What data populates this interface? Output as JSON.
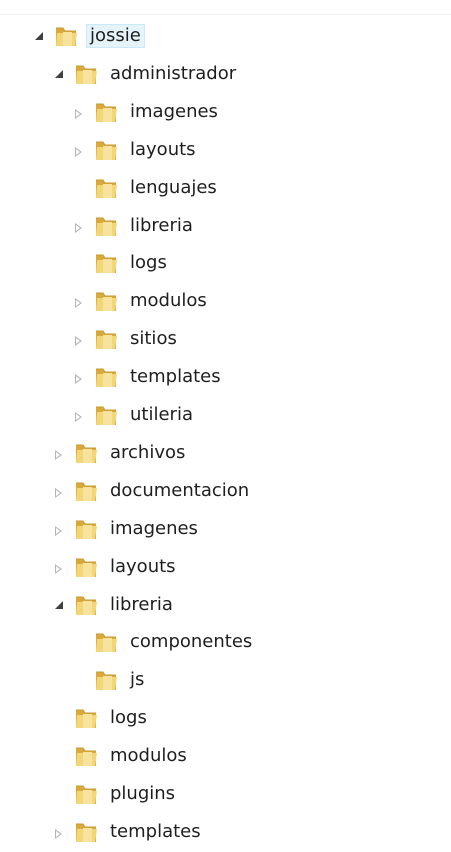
{
  "tree": {
    "nodes": [
      {
        "name": "jossie",
        "depth": 0,
        "state": "expanded",
        "selected": true
      },
      {
        "name": "administrador",
        "depth": 1,
        "state": "expanded"
      },
      {
        "name": "imagenes",
        "depth": 2,
        "state": "collapsed"
      },
      {
        "name": "layouts",
        "depth": 2,
        "state": "collapsed"
      },
      {
        "name": "lenguajes",
        "depth": 2,
        "state": "leaf"
      },
      {
        "name": "libreria",
        "depth": 2,
        "state": "collapsed"
      },
      {
        "name": "logs",
        "depth": 2,
        "state": "leaf"
      },
      {
        "name": "modulos",
        "depth": 2,
        "state": "collapsed"
      },
      {
        "name": "sitios",
        "depth": 2,
        "state": "collapsed"
      },
      {
        "name": "templates",
        "depth": 2,
        "state": "collapsed"
      },
      {
        "name": "utileria",
        "depth": 2,
        "state": "collapsed"
      },
      {
        "name": "archivos",
        "depth": 1,
        "state": "collapsed"
      },
      {
        "name": "documentacion",
        "depth": 1,
        "state": "collapsed"
      },
      {
        "name": "imagenes",
        "depth": 1,
        "state": "collapsed"
      },
      {
        "name": "layouts",
        "depth": 1,
        "state": "collapsed"
      },
      {
        "name": "libreria",
        "depth": 1,
        "state": "expanded"
      },
      {
        "name": "componentes",
        "depth": 2,
        "state": "leaf"
      },
      {
        "name": "js",
        "depth": 2,
        "state": "leaf"
      },
      {
        "name": "logs",
        "depth": 1,
        "state": "leaf"
      },
      {
        "name": "modulos",
        "depth": 1,
        "state": "leaf"
      },
      {
        "name": "plugins",
        "depth": 1,
        "state": "leaf"
      },
      {
        "name": "templates",
        "depth": 1,
        "state": "collapsed"
      }
    ]
  },
  "colors": {
    "selection_bg": "#e5f3fb",
    "expander_collapsed": "#b6b6b6",
    "expander_expanded": "#404040",
    "folder": "#e8c35a"
  },
  "icons": {
    "folder": "folder-icon",
    "expand": "expand-arrow-icon",
    "collapse": "collapse-arrow-icon"
  }
}
